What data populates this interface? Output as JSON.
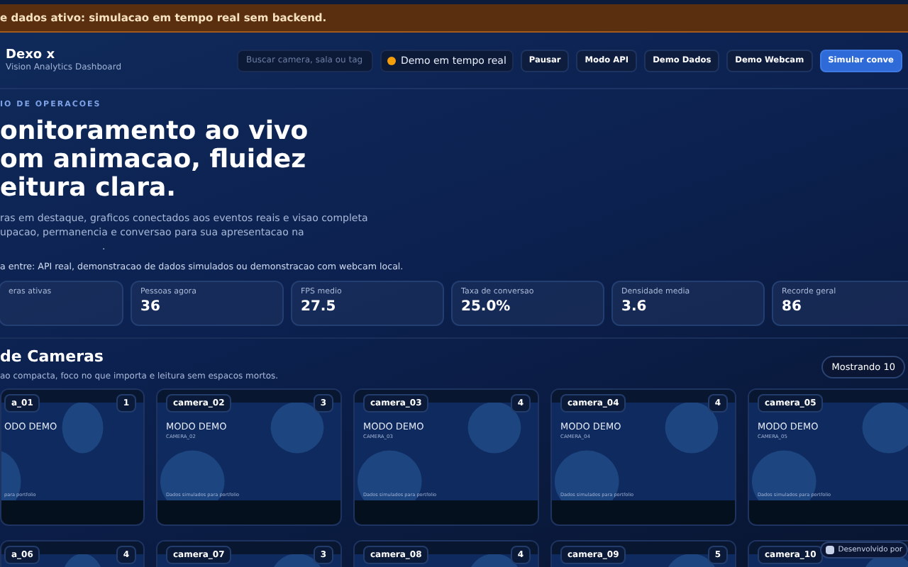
{
  "banner": {
    "text": "e dados ativo: simulacao em tempo real sem backend."
  },
  "header": {
    "brand": "Dexo x",
    "subtitle": "Vision Analytics Dashboard",
    "search": {
      "placeholder": "Buscar camera, sala ou tag"
    },
    "status": {
      "label": "Demo em tempo real",
      "color": "#f59e0b"
    },
    "buttons": [
      {
        "label": "Pausar",
        "kind": "plain"
      },
      {
        "label": "Modo API",
        "kind": "plain"
      },
      {
        "label": "Demo Dados",
        "kind": "plain"
      },
      {
        "label": "Demo Webcam",
        "kind": "plain"
      },
      {
        "label": "Simular conve",
        "kind": "primary"
      }
    ]
  },
  "hero": {
    "eyebrow": "IO DE OPERACOES",
    "title_lines": [
      "onitoramento ao vivo",
      "om animacao, fluidez",
      "eitura clara."
    ],
    "description_lines": [
      "ras em destaque, graficos conectados aos eventos reais e visao completa",
      "upacao, permanencia e conversao para sua apresentacao na",
      "."
    ],
    "note": "a entre: API real, demonstracao de dados simulados ou demonstracao com webcam local."
  },
  "stats": [
    {
      "label": "eras ativas"
    },
    {
      "label": "Pessoas agora",
      "value": "36"
    },
    {
      "label": "FPS medio",
      "value": "27.5"
    },
    {
      "label": "Taxa de conversao",
      "value": "25.0%"
    },
    {
      "label": "Densidade media",
      "value": "3.6"
    },
    {
      "label": "Recorde geral",
      "value": "86"
    }
  ],
  "cameras_section": {
    "title": "de Cameras",
    "subtitle": "ao compacta, foco no que importa e leitura sem espacos mortos.",
    "count_badge": "Mostrando 10"
  },
  "cameras": [
    {
      "label": "a_01",
      "count": "1",
      "mode": "ODO DEMO",
      "note": "para portfolio"
    },
    {
      "label": "camera_02",
      "count": "3",
      "mode": "MODO DEMO",
      "code": "CAMERA_02",
      "note": "Dados simulados para portfolio"
    },
    {
      "label": "camera_03",
      "count": "4",
      "mode": "MODO DEMO",
      "code": "CAMERA_03",
      "note": "Dados simulados para portfolio"
    },
    {
      "label": "camera_04",
      "count": "4",
      "mode": "MODO DEMO",
      "code": "CAMERA_04",
      "note": "Dados simulados para portfolio"
    },
    {
      "label": "camera_05",
      "mode": "MODO DEMO",
      "code": "CAMERA_05",
      "note": "Dados simulados para portfolio"
    },
    {
      "label": "a_06",
      "count": "4"
    },
    {
      "label": "camera_07",
      "count": "3"
    },
    {
      "label": "camera_08",
      "count": "4"
    },
    {
      "label": "camera_09",
      "count": "5"
    },
    {
      "label": "camera_10"
    }
  ],
  "footer_chip": {
    "text": "Desenvolvido por"
  }
}
